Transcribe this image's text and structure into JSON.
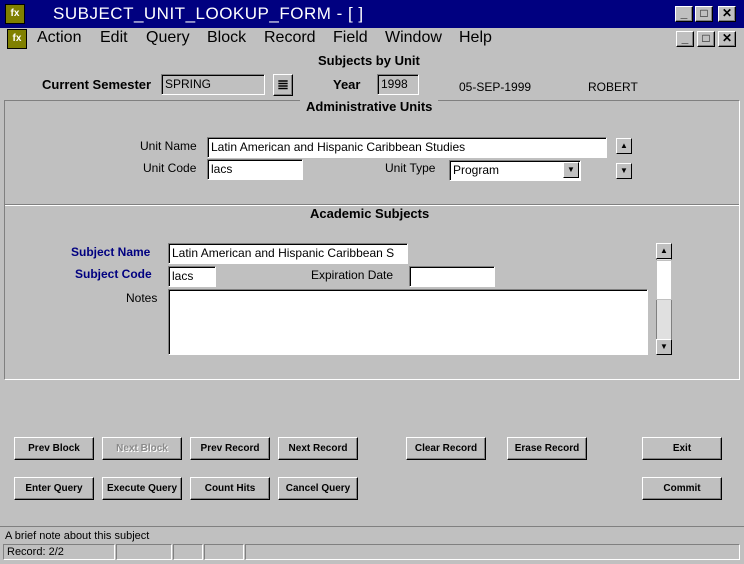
{
  "window": {
    "title": "SUBJECT_UNIT_LOOKUP_FORM - [ ]",
    "minimize": "_",
    "maximize": "□",
    "close": "✕",
    "restore": "🗗",
    "icon_text": "fx"
  },
  "menu": [
    "Action",
    "Edit",
    "Query",
    "Block",
    "Record",
    "Field",
    "Window",
    "Help"
  ],
  "form": {
    "heading": "Subjects by Unit",
    "current_semester_label": "Current Semester",
    "current_semester_value": "SPRING",
    "year_label": "Year",
    "year_value": "1998",
    "date": "05-SEP-1999",
    "user": "ROBERT"
  },
  "admin_units": {
    "title": "Administrative Units",
    "unit_name_label": "Unit Name",
    "unit_name_value": "Latin American and Hispanic Caribbean Studies",
    "unit_code_label": "Unit Code",
    "unit_code_value": "lacs",
    "unit_type_label": "Unit Type",
    "unit_type_value": "Program"
  },
  "academic_subjects": {
    "title": "Academic Subjects",
    "subject_name_label": "Subject Name",
    "subject_name_value": "Latin American and Hispanic Caribbean S",
    "subject_code_label": "Subject Code",
    "subject_code_value": "lacs",
    "expiration_label": "Expiration Date",
    "expiration_value": "",
    "notes_label": "Notes",
    "notes_value": ""
  },
  "buttons": {
    "prev_block": "Prev Block",
    "next_block": "Next Block",
    "prev_record": "Prev Record",
    "next_record": "Next Record",
    "clear_record": "Clear Record",
    "erase_record": "Erase Record",
    "exit": "Exit",
    "enter_query": "Enter Query",
    "execute_query": "Execute Query",
    "count_hits": "Count Hits",
    "cancel_query": "Cancel Query",
    "commit": "Commit"
  },
  "status": {
    "hint": "A brief note about this subject",
    "record": "Record: 2/2"
  }
}
